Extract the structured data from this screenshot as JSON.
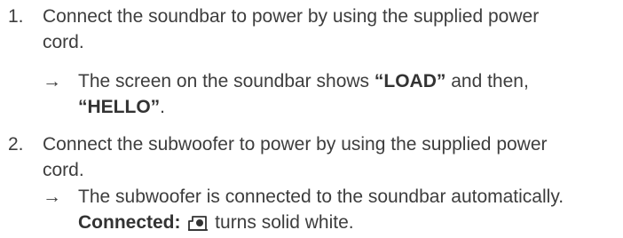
{
  "steps": [
    {
      "number": "1.",
      "text_line1": "Connect the soundbar to power by using the supplied power",
      "text_line2": "cord.",
      "result": {
        "arrow": "→",
        "prefix": "The screen on the soundbar shows ",
        "load": "“LOAD”",
        "middle": " and then,",
        "hello": "“HELLO”",
        "suffix": "."
      }
    },
    {
      "number": "2.",
      "text_line1": "Connect the subwoofer to power by using the supplied power",
      "text_line2": "cord.",
      "result": {
        "arrow": "→",
        "line1": "The subwoofer is connected to the soundbar automatically.",
        "connected_label": "Connected:",
        "icon": "subwoofer-icon",
        "suffix": " turns solid white."
      }
    }
  ]
}
